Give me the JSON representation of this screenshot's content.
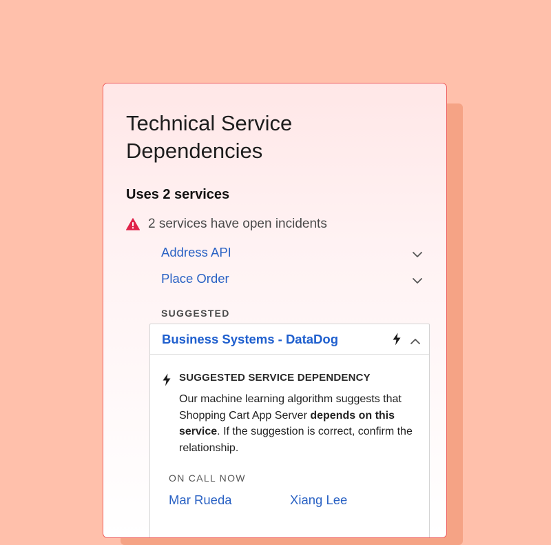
{
  "card": {
    "title": "Technical Service Dependencies",
    "uses_heading": "Uses 2 services",
    "incidents_text": "2 services have open incidents",
    "services": [
      {
        "label": "Address API"
      },
      {
        "label": "Place Order"
      }
    ],
    "suggested_label": "SUGGESTED",
    "suggested": {
      "name": "Business Systems - DataDog",
      "dependency_title": "SUGGESTED SERVICE DEPENDENCY",
      "body_part1": "Our machine learning algorithm suggests that Shopping Cart App Server ",
      "body_bold": "depends on this service",
      "body_part2": ".  If the suggestion is correct, confirm the relationship.",
      "oncall_label": "ON CALL NOW",
      "oncall": [
        {
          "name": "Mar Rueda"
        },
        {
          "name": "Xiang Lee"
        }
      ]
    }
  },
  "icons": {
    "warning": "warning-triangle-icon",
    "chevron": "chevron-down-icon",
    "collapse": "chevron-up-icon",
    "bolt": "lightning-bolt-icon"
  },
  "colors": {
    "background": "#ffc0ab",
    "card_border": "#ef5d5d",
    "link": "#2a62c4",
    "warning": "#e0234a"
  }
}
